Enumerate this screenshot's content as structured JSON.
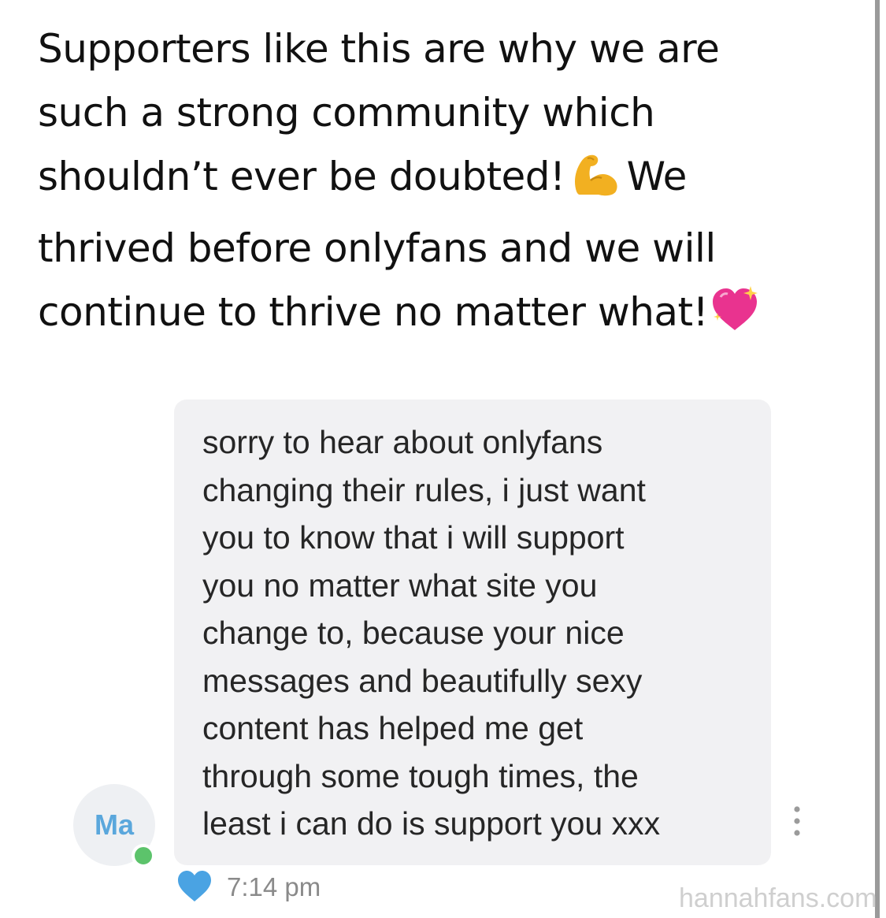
{
  "tweet": {
    "lines": [
      "Supporters like this are why we are",
      "such a strong community which",
      "shouldn’t ever be doubted!",
      "We",
      "thrived before onlyfans and we will",
      "continue to thrive no matter what!"
    ],
    "emojis": [
      "flexed-biceps",
      "sparkling-heart"
    ]
  },
  "message": {
    "lines": [
      "sorry to hear about onlyfans",
      "changing their rules, i just want",
      "you to know that i will support",
      "you no matter what site you",
      "change to, because your nice",
      "messages and beautifully sexy",
      "content has helped me get",
      "through some tough times, the",
      "least i can do is support you xxx"
    ],
    "avatar_initials": "Ma",
    "timestamp": "7:14 pm",
    "liked": true
  },
  "watermark": "hannahfans.com",
  "colors": {
    "bubble": "#f1f1f3",
    "avatar_text": "#5aa7dc",
    "online": "#5cc36b",
    "heart": "#4aa3e3",
    "timestamp": "#8a8a8a"
  }
}
